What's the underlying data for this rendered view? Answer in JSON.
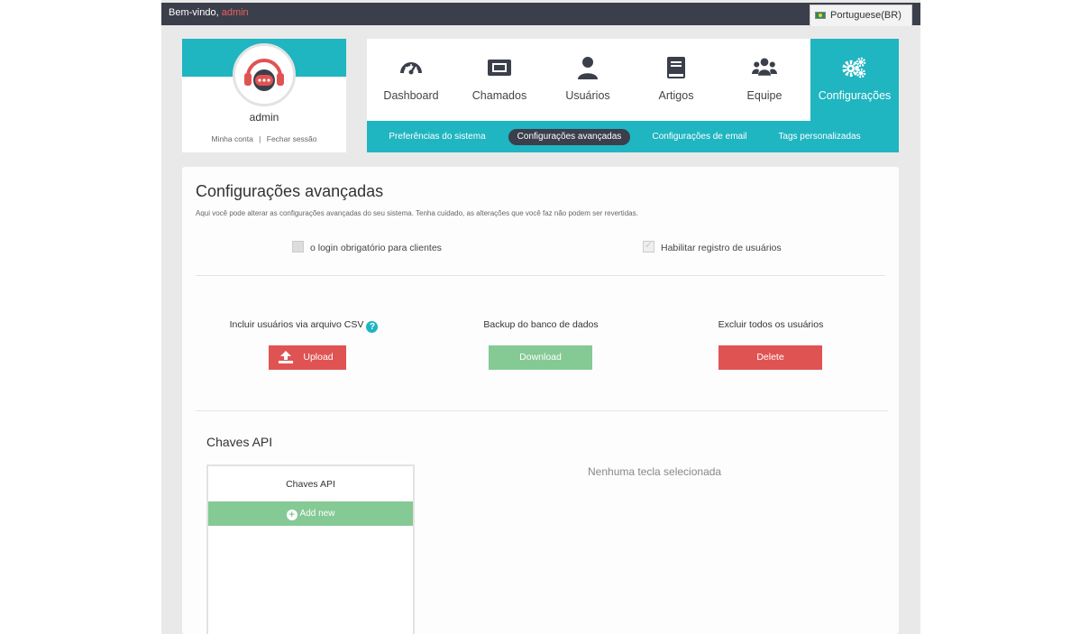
{
  "topbar": {
    "welcome_prefix": "Bem-vindo,",
    "username": "admin",
    "language": "Portuguese(BR)"
  },
  "profile": {
    "name": "admin",
    "my_account": "Minha conta",
    "separator": "|",
    "logout": "Fechar sessão"
  },
  "nav": {
    "items": [
      {
        "label": "Dashboard",
        "icon": "dashboard-gauge-icon"
      },
      {
        "label": "Chamados",
        "icon": "ticket-icon"
      },
      {
        "label": "Usuários",
        "icon": "user-icon"
      },
      {
        "label": "Artigos",
        "icon": "book-icon"
      },
      {
        "label": "Equipe",
        "icon": "team-icon"
      },
      {
        "label": "Configurações",
        "icon": "gears-icon",
        "active": true
      }
    ],
    "subitems": [
      {
        "label": "Preferências do sistema"
      },
      {
        "label": "Configurações avançadas",
        "active": true
      },
      {
        "label": "Configurações de email"
      },
      {
        "label": "Tags personalizadas"
      }
    ]
  },
  "main": {
    "title": "Configurações avançadas",
    "description": "Aqui você pode alterar as configurações avançadas do seu sistema. Tenha cuidado, as alterações que você faz não podem ser revertidas.",
    "checkbox_login": "o login obrigatório para clientes",
    "checkbox_register": "Habilitar registro de usuários",
    "csv_label": "Incluir usuários via arquivo CSV",
    "help_mark": "?",
    "upload_button": "Upload",
    "backup_label": "Backup do banco de dados",
    "download_button": "Download",
    "delete_label": "Excluir todos os usuários",
    "delete_button": "Delete",
    "api_title": "Chaves API",
    "api_box_title": "Chaves API",
    "add_new": "Add new",
    "no_key": "Nenhuma tecla selecionada"
  },
  "colors": {
    "accent": "#1fb5c1",
    "topbar": "#3b3f4b",
    "danger": "#e05353",
    "success": "#85c995"
  }
}
